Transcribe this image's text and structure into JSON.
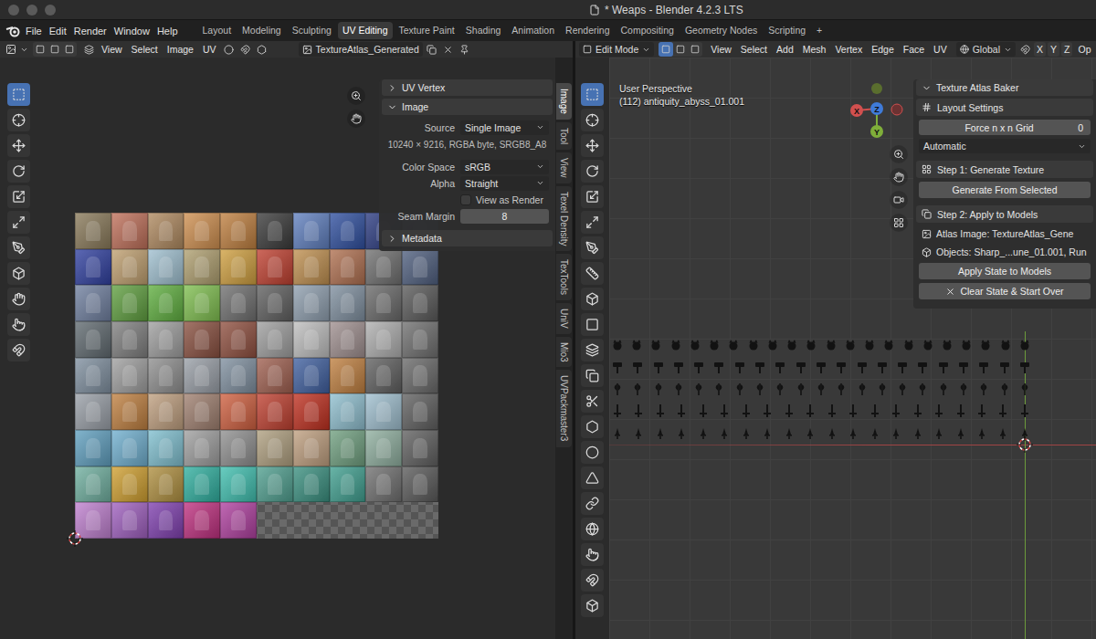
{
  "window": {
    "title": "* Weaps - Blender 4.2.3 LTS"
  },
  "menu": [
    "File",
    "Edit",
    "Render",
    "Window",
    "Help"
  ],
  "workspaces": [
    {
      "label": "Layout",
      "selected": false
    },
    {
      "label": "Modeling",
      "selected": false
    },
    {
      "label": "Sculpting",
      "selected": false
    },
    {
      "label": "UV Editing",
      "selected": true
    },
    {
      "label": "Texture Paint",
      "selected": false
    },
    {
      "label": "Shading",
      "selected": false
    },
    {
      "label": "Animation",
      "selected": false
    },
    {
      "label": "Rendering",
      "selected": false
    },
    {
      "label": "Compositing",
      "selected": false
    },
    {
      "label": "Geometry Nodes",
      "selected": false
    },
    {
      "label": "Scripting",
      "selected": false
    }
  ],
  "add_workspace": "+",
  "uv_editor": {
    "menus": [
      "View",
      "Select",
      "Image",
      "UV"
    ],
    "image_name": "TextureAtlas_Generated",
    "tools": [
      {
        "selected": true
      },
      {
        "selected": false
      },
      {
        "selected": false
      },
      {
        "selected": false
      },
      {
        "selected": false
      },
      {
        "selected": false
      },
      {
        "selected": false
      },
      {
        "selected": false
      },
      {
        "selected": false
      },
      {
        "selected": false
      },
      {
        "selected": false
      }
    ],
    "sidebar_tabs": [
      {
        "label": "Image",
        "selected": true
      },
      {
        "label": "Tool",
        "selected": false
      },
      {
        "label": "View",
        "selected": false
      },
      {
        "label": "Texel Density",
        "selected": false
      },
      {
        "label": "TexTools",
        "selected": false
      },
      {
        "label": "UniV",
        "selected": false
      },
      {
        "label": "Mio3",
        "selected": false
      },
      {
        "label": "UVPackmaster3",
        "selected": false
      }
    ],
    "panels": [
      {
        "title": "UV Vertex",
        "expanded": false,
        "fields": []
      },
      {
        "title": "Image",
        "expanded": true,
        "fields": [
          {
            "kind": "select",
            "label": "Source",
            "value": "Single Image"
          },
          {
            "kind": "info",
            "value": "10240 × 9216, RGBA byte, SRGB8_A8"
          },
          {
            "kind": "select",
            "label": "Color Space",
            "value": "sRGB"
          },
          {
            "kind": "select",
            "label": "Alpha",
            "value": "Straight"
          },
          {
            "kind": "checkbox",
            "label": "View as Render",
            "checked": false
          },
          {
            "kind": "number",
            "label": "Seam Margin",
            "value": "8"
          }
        ]
      },
      {
        "title": "Metadata",
        "expanded": false,
        "fields": []
      }
    ]
  },
  "viewport": {
    "mode": "Edit Mode",
    "select_modes": [
      {
        "selected": true
      },
      {
        "selected": false
      },
      {
        "selected": false
      }
    ],
    "menus": [
      "View",
      "Select",
      "Add",
      "Mesh",
      "Vertex",
      "Edge",
      "Face",
      "UV"
    ],
    "orientation": "Global",
    "axes": [
      {
        "label": "X",
        "selected": false
      },
      {
        "label": "Y",
        "selected": false
      },
      {
        "label": "Z",
        "selected": false
      }
    ],
    "options": "Op",
    "view_name": "User Perspective",
    "object_info": "(112) antiquity_abyss_01.001",
    "gizmo": {
      "x": "X",
      "y": "Y",
      "z": "Z"
    },
    "tools": [
      {
        "selected": true
      },
      {
        "selected": false
      },
      {
        "selected": false
      },
      {
        "selected": false
      },
      {
        "selected": false
      },
      {
        "selected": false
      },
      {
        "selected": false
      },
      {
        "selected": false
      },
      {
        "selected": false
      },
      {
        "selected": false
      },
      {
        "selected": false
      },
      {
        "selected": false
      },
      {
        "selected": false
      },
      {
        "selected": false
      },
      {
        "selected": false
      },
      {
        "selected": false
      },
      {
        "selected": false
      },
      {
        "selected": false
      },
      {
        "selected": false
      },
      {
        "selected": false
      },
      {
        "selected": false
      }
    ],
    "addon_panel": {
      "title": "Texture Atlas Baker",
      "expanded": true,
      "layout_section": {
        "title": "Layout Settings",
        "grid_label": "Force n x n Grid",
        "grid_value": "0",
        "mode": "Automatic"
      },
      "step1": {
        "title": "Step 1: Generate Texture",
        "button": "Generate From Selected"
      },
      "step2": {
        "title": "Step 2: Apply to Models",
        "atlas": "Atlas Image: TextureAtlas_Gene",
        "objects": "Objects: Sharp_...une_01.001, Run",
        "apply_button": "Apply State to Models",
        "clear_button": "Clear State & Start Over"
      }
    }
  }
}
